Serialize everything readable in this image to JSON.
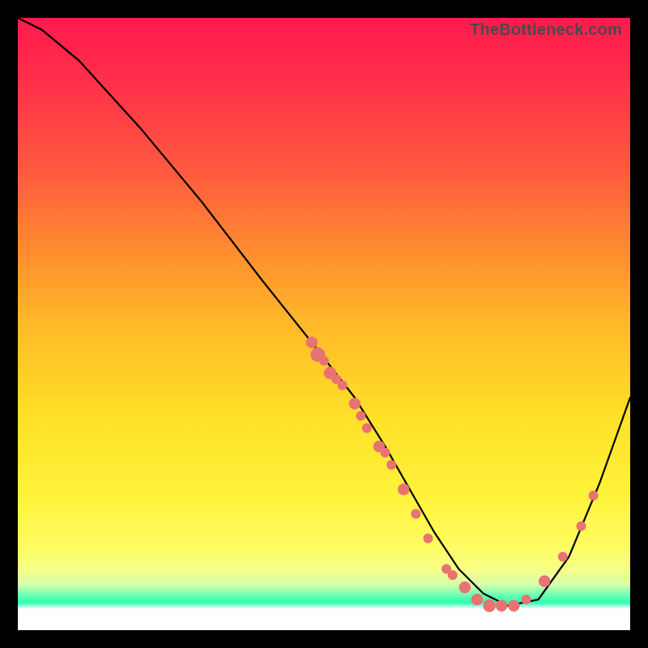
{
  "watermark": "TheBottleneck.com",
  "colors": {
    "dot": "#e97272",
    "curve": "#000000",
    "gradient_top": "#ff1a4d",
    "gradient_mid": "#fff23a",
    "gradient_green": "#2cffb0",
    "gradient_bottom": "#ffffff"
  },
  "chart_data": {
    "type": "line",
    "title": "",
    "xlabel": "",
    "ylabel": "",
    "xlim": [
      0,
      100
    ],
    "ylim": [
      0,
      100
    ],
    "grid": false,
    "legend": false,
    "series": [
      {
        "name": "curve",
        "x": [
          0,
          4,
          10,
          20,
          30,
          40,
          48,
          55,
          60,
          64,
          68,
          72,
          76,
          80,
          85,
          90,
          95,
          100
        ],
        "y": [
          100,
          98,
          93,
          82,
          70,
          57,
          47,
          38,
          30,
          23,
          16,
          10,
          6,
          4,
          5,
          12,
          24,
          38
        ]
      }
    ],
    "scatter_points": {
      "name": "dots",
      "approx": true,
      "points": [
        {
          "x": 48,
          "y": 47,
          "r": 1.2
        },
        {
          "x": 49,
          "y": 45,
          "r": 1.5
        },
        {
          "x": 50,
          "y": 44,
          "r": 1.0
        },
        {
          "x": 51,
          "y": 42,
          "r": 1.3
        },
        {
          "x": 52,
          "y": 41,
          "r": 1.0
        },
        {
          "x": 53,
          "y": 40,
          "r": 1.0
        },
        {
          "x": 55,
          "y": 37,
          "r": 1.2
        },
        {
          "x": 56,
          "y": 35,
          "r": 1.0
        },
        {
          "x": 57,
          "y": 33,
          "r": 1.0
        },
        {
          "x": 59,
          "y": 30,
          "r": 1.2
        },
        {
          "x": 60,
          "y": 29,
          "r": 1.0
        },
        {
          "x": 61,
          "y": 27,
          "r": 1.0
        },
        {
          "x": 63,
          "y": 23,
          "r": 1.2
        },
        {
          "x": 65,
          "y": 19,
          "r": 1.0
        },
        {
          "x": 67,
          "y": 15,
          "r": 1.0
        },
        {
          "x": 70,
          "y": 10,
          "r": 1.0
        },
        {
          "x": 71,
          "y": 9,
          "r": 1.0
        },
        {
          "x": 73,
          "y": 7,
          "r": 1.2
        },
        {
          "x": 75,
          "y": 5,
          "r": 1.2
        },
        {
          "x": 77,
          "y": 4,
          "r": 1.3
        },
        {
          "x": 79,
          "y": 4,
          "r": 1.2
        },
        {
          "x": 81,
          "y": 4,
          "r": 1.2
        },
        {
          "x": 83,
          "y": 5,
          "r": 1.0
        },
        {
          "x": 86,
          "y": 8,
          "r": 1.2
        },
        {
          "x": 89,
          "y": 12,
          "r": 1.0
        },
        {
          "x": 92,
          "y": 17,
          "r": 1.0
        },
        {
          "x": 94,
          "y": 22,
          "r": 1.0
        }
      ]
    }
  }
}
